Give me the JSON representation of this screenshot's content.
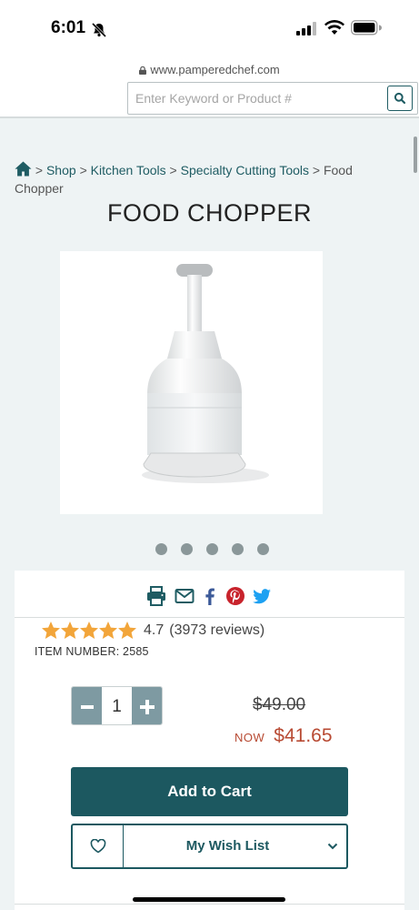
{
  "status": {
    "time": "6:01"
  },
  "browser": {
    "url": "www.pamperedchef.com"
  },
  "search": {
    "placeholder": "Enter Keyword or Product #"
  },
  "breadcrumb": {
    "separator": ">",
    "items": [
      "Shop",
      "Kitchen Tools",
      "Specialty Cutting Tools",
      "Food Chopper"
    ]
  },
  "product": {
    "title": "FOOD CHOPPER",
    "rating": "4.7",
    "stars": 5,
    "reviews": "(3973 reviews)",
    "item_number": "ITEM NUMBER: 2585",
    "quantity": "1",
    "old_price": "$49.00",
    "now_label": "NOW",
    "now_price": "$41.65",
    "image_count": 5
  },
  "actions": {
    "add_to_cart": "Add to Cart",
    "wish_list": "My Wish List"
  },
  "share_icons": [
    "print-icon",
    "email-icon",
    "facebook-icon",
    "pinterest-icon",
    "twitter-icon"
  ],
  "colors": {
    "brand_teal": "#1c5860",
    "price_red": "#b84a33",
    "star_orange": "#f2a53a",
    "qty_button": "#7e9aa2",
    "pinterest": "#c8232c",
    "twitter": "#1da1f2",
    "facebook": "#3b5998"
  }
}
